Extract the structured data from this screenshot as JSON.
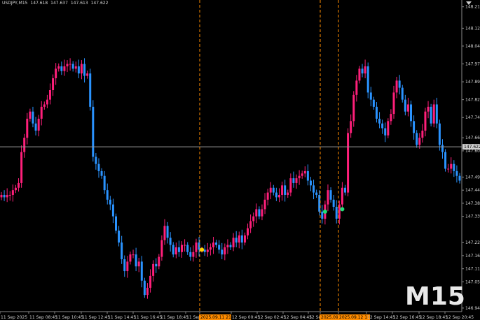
{
  "header": {
    "symbol": "USDJPY,M15",
    "open": "147.618",
    "high": "147.637",
    "low": "147.613",
    "close": "147.622"
  },
  "timeframe_badge": "M15",
  "current_price": "147.622",
  "colors": {
    "background": "#000000",
    "bull": "#ff1f7a",
    "bear": "#2a93ff",
    "grid_text": "#d0d0d0",
    "vline": "#ff8c00",
    "price_line": "#9a9a9a",
    "signal_yellow": "#ffd400",
    "signal_green": "#22dd77",
    "current_price_tag": "#2b2b2b"
  },
  "chart_data": {
    "type": "candlestick",
    "y_axis_ticks": [
      "148.210",
      "148.120",
      "148.045",
      "147.970",
      "147.895",
      "147.820",
      "147.745",
      "147.660",
      "147.605",
      "147.495",
      "147.440",
      "147.385",
      "147.330",
      "147.220",
      "147.165",
      "147.110",
      "147.055",
      "146.945"
    ],
    "ylim": [
      146.93,
      148.215
    ],
    "x_axis_ticks": [
      "11 Sep 2025",
      "11 Sep 08:45",
      "11 Sep 10:45",
      "11 Sep 12:45",
      "11 Sep 14:45",
      "11 Sep 16:45",
      "11 Sep 18:45",
      "11 Sep 20:45",
      "2025.09.11 21:30",
      "12 Sep 00:45",
      "12 Sep 02:45",
      "12 Sep 04:45",
      "12 Sep 06:45",
      "2025.09.12 09:30",
      "2025.09.12 11:00",
      "12 Sep 14:45",
      "12 Sep 16:45",
      "12 Sep 18:45",
      "12 Sep 20:45"
    ],
    "highlighted_ticks": [
      "2025.09.11 21:30",
      "2025.09.12 09:30",
      "2025.09.12 11:00"
    ],
    "vertical_markers": [
      "2025.09.11 21:30",
      "2025.09.12 09:30",
      "2025.09.12 11:00"
    ],
    "current_price": 147.622,
    "signals": [
      {
        "time_index": 70,
        "price": 147.19,
        "color": "yellow"
      },
      {
        "time_index": 113,
        "price": 147.35,
        "color": "green"
      },
      {
        "time_index": 119,
        "price": 147.36,
        "color": "green"
      }
    ],
    "close_series": [
      147.42,
      147.41,
      147.42,
      147.42,
      147.44,
      147.45,
      147.47,
      147.6,
      147.66,
      147.74,
      147.77,
      147.72,
      147.69,
      147.74,
      147.79,
      147.8,
      147.82,
      147.86,
      147.91,
      147.95,
      147.96,
      147.94,
      147.96,
      147.97,
      147.97,
      147.95,
      147.96,
      147.93,
      147.97,
      147.92,
      147.93,
      147.79,
      147.58,
      147.55,
      147.52,
      147.5,
      147.44,
      147.4,
      147.38,
      147.33,
      147.27,
      147.22,
      147.15,
      147.1,
      147.14,
      147.17,
      147.17,
      147.12,
      147.14,
      147.06,
      147.0,
      147.03,
      147.08,
      147.13,
      147.12,
      147.16,
      147.23,
      147.29,
      147.24,
      147.21,
      147.17,
      147.2,
      147.18,
      147.21,
      147.21,
      147.18,
      147.16,
      147.18,
      147.22,
      147.19,
      147.19,
      147.18,
      147.19,
      147.2,
      147.22,
      147.21,
      147.19,
      147.17,
      147.2,
      147.21,
      147.2,
      147.24,
      147.22,
      147.25,
      147.22,
      147.25,
      147.28,
      147.31,
      147.33,
      147.36,
      147.33,
      147.36,
      147.4,
      147.43,
      147.45,
      147.43,
      147.41,
      147.42,
      147.46,
      147.42,
      147.43,
      147.49,
      147.47,
      147.49,
      147.5,
      147.51,
      147.52,
      147.48,
      147.46,
      147.43,
      147.42,
      147.35,
      147.32,
      147.38,
      147.44,
      147.4,
      147.37,
      147.32,
      147.38,
      147.45,
      147.43,
      147.68,
      147.73,
      147.84,
      147.9,
      147.95,
      147.93,
      147.96,
      147.85,
      147.82,
      147.79,
      147.74,
      147.72,
      147.7,
      147.67,
      147.73,
      147.76,
      147.85,
      147.9,
      147.87,
      147.82,
      147.77,
      147.8,
      147.73,
      147.68,
      147.63,
      147.66,
      147.69,
      147.77,
      147.79,
      147.72,
      147.8,
      147.72,
      147.63,
      147.6,
      147.53,
      147.53,
      147.55,
      147.52,
      147.5,
      147.48
    ]
  }
}
